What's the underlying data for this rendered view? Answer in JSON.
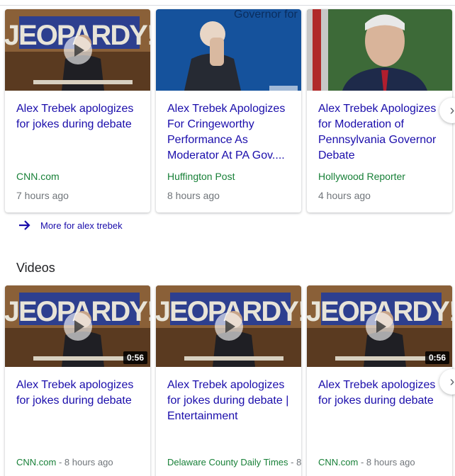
{
  "top_stories": [
    {
      "title": "Alex Trebek apologizes for jokes during debate",
      "source": "CNN.com",
      "time": "7 hours ago",
      "image": "jeopardy-set-thumbnail",
      "has_play": true
    },
    {
      "title": "Alex Trebek Apologizes For Cringeworthy Performance As Moderator At PA Gov....",
      "source": "Huffington Post",
      "time": "8 hours ago",
      "image": "governor-debate-photo",
      "backdrop_text": "Governor for"
    },
    {
      "title": "Alex Trebek Apologizes for Moderation of Pennsylvania Governor Debate",
      "source": "Hollywood Reporter",
      "time": "4 hours ago",
      "image": "trebek-portrait-photo"
    }
  ],
  "more_link": {
    "label": "More for alex trebek",
    "icon": "arrow-right-icon"
  },
  "videos_section": {
    "title": "Videos"
  },
  "videos": [
    {
      "title": "Alex Trebek apologizes for jokes during debate",
      "source": "CNN.com",
      "sep": " - ",
      "time": "8 hours ago",
      "duration": "0:56"
    },
    {
      "title": "Alex Trebek apologizes for jokes during debate | Entertainment",
      "source": "Delaware County Daily Times",
      "sep": " - ",
      "time": "8",
      "duration": ""
    },
    {
      "title": "Alex Trebek apologizes for jokes during debate",
      "source": "CNN.com",
      "sep": " - ",
      "time": "8 hours ago",
      "duration": "0:56"
    }
  ],
  "thumbnail_text": {
    "logo": "JEOPARDY!"
  },
  "colors": {
    "link": "#1a0dab",
    "source": "#188038",
    "meta": "#70757a"
  }
}
